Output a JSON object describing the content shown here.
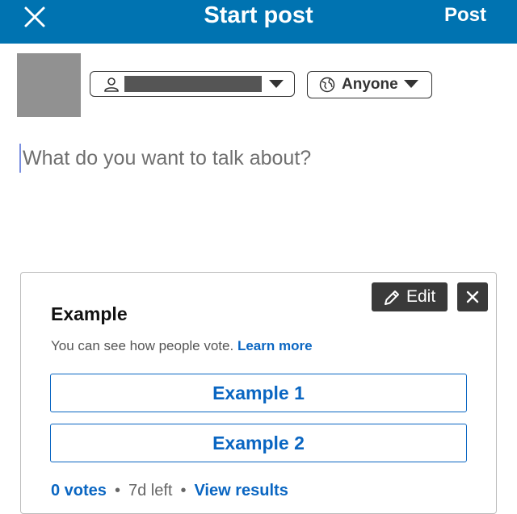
{
  "header": {
    "title": "Start post",
    "post_label": "Post",
    "background_color": "#0073b1",
    "close_icon": "close-icon"
  },
  "author": {
    "name_select_icon": "person-icon",
    "visibility_label": "Anyone",
    "visibility_icon": "globe-icon"
  },
  "composer": {
    "placeholder": "What do you want to talk about?"
  },
  "poll": {
    "edit_label": "Edit",
    "edit_icon": "pencil-icon",
    "remove_icon": "close-icon",
    "question": "Example",
    "note_text": "You can see how people vote.",
    "learn_more_label": "Learn more",
    "options": [
      {
        "label": "Example 1"
      },
      {
        "label": "Example 2"
      }
    ],
    "footer": {
      "votes_label": "0 votes",
      "time_left": "7d left",
      "view_results_label": "View results",
      "separator": "•"
    }
  },
  "colors": {
    "accent": "#0a66c2",
    "dark_button": "#3a3a3a",
    "avatar_placeholder": "#919191"
  }
}
